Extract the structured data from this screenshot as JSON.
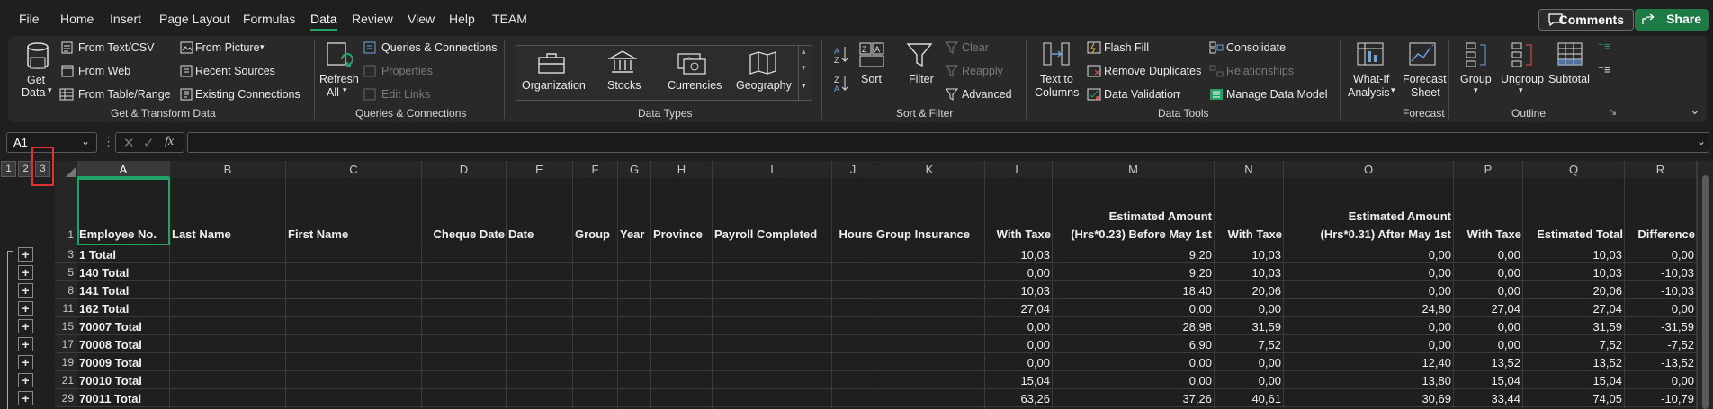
{
  "menu": {
    "tabs": [
      "File",
      "Home",
      "Insert",
      "Page Layout",
      "Formulas",
      "Data",
      "Review",
      "View",
      "Help",
      "TEAM"
    ],
    "active": "Data",
    "comments": "Comments",
    "share": "Share"
  },
  "ribbon": {
    "get_transform": {
      "get_data": "Get",
      "get_data2": "Data",
      "from_text_csv": "From Text/CSV",
      "from_web": "From Web",
      "from_table_range": "From Table/Range",
      "from_picture": "From Picture",
      "recent_sources": "Recent Sources",
      "existing_connections": "Existing Connections",
      "group": "Get & Transform Data"
    },
    "queries": {
      "refresh": "Refresh",
      "refresh2": "All",
      "queries_connections": "Queries & Connections",
      "properties": "Properties",
      "edit_links": "Edit Links",
      "group": "Queries & Connections"
    },
    "data_types": {
      "organization": "Organization",
      "stocks": "Stocks",
      "currencies": "Currencies",
      "geography": "Geography",
      "group": "Data Types"
    },
    "sort_filter": {
      "sort": "Sort",
      "filter": "Filter",
      "clear": "Clear",
      "reapply": "Reapply",
      "advanced": "Advanced",
      "group": "Sort & Filter"
    },
    "data_tools": {
      "text_to_columns": "Text to",
      "text_to_columns2": "Columns",
      "flash_fill": "Flash Fill",
      "remove_duplicates": "Remove Duplicates",
      "data_validation": "Data Validation",
      "consolidate": "Consolidate",
      "relationships": "Relationships",
      "manage_data_model": "Manage Data Model",
      "group": "Data Tools"
    },
    "forecast": {
      "what_if": "What-If",
      "what_if2": "Analysis",
      "forecast_sheet": "Forecast",
      "forecast_sheet2": "Sheet",
      "group": "Forecast"
    },
    "outline": {
      "group_btn": "Group",
      "ungroup": "Ungroup",
      "subtotal": "Subtotal",
      "group": "Outline"
    }
  },
  "formula_bar": {
    "name_box": "A1",
    "fx": "fx",
    "value": ""
  },
  "outline_levels": [
    "1",
    "2",
    "3"
  ],
  "columns": [
    "A",
    "B",
    "C",
    "D",
    "E",
    "F",
    "G",
    "H",
    "I",
    "J",
    "K",
    "L",
    "M",
    "N",
    "O",
    "P",
    "Q",
    "R"
  ],
  "headers": {
    "A": "Employee No.",
    "B": "Last Name",
    "C": "First Name",
    "D": "Cheque Date",
    "E": "Date",
    "F": "Group",
    "G": "Year",
    "H": "Province",
    "I": "Payroll Completed",
    "J": "Hours",
    "K": "Group Insurance",
    "L": "With Taxe",
    "M1": "Estimated Amount",
    "M2": "(Hrs*0.23) Before May 1st",
    "N": "With Taxe",
    "O1": "Estimated Amount",
    "O2": "(Hrs*0.31) After May 1st",
    "P": "With Taxe",
    "Q": "Estimated Total",
    "R": "Difference"
  },
  "rows": [
    {
      "num": "3",
      "A": "1 Total",
      "L": "10,03",
      "M": "9,20",
      "N": "10,03",
      "O": "0,00",
      "P": "0,00",
      "Q": "10,03",
      "R": "0,00"
    },
    {
      "num": "5",
      "A": "140 Total",
      "L": "0,00",
      "M": "9,20",
      "N": "10,03",
      "O": "0,00",
      "P": "0,00",
      "Q": "10,03",
      "R": "-10,03"
    },
    {
      "num": "8",
      "A": "141 Total",
      "L": "10,03",
      "M": "18,40",
      "N": "20,06",
      "O": "0,00",
      "P": "0,00",
      "Q": "20,06",
      "R": "-10,03"
    },
    {
      "num": "11",
      "A": "162 Total",
      "L": "27,04",
      "M": "0,00",
      "N": "0,00",
      "O": "24,80",
      "P": "27,04",
      "Q": "27,04",
      "R": "0,00"
    },
    {
      "num": "15",
      "A": "70007 Total",
      "L": "0,00",
      "M": "28,98",
      "N": "31,59",
      "O": "0,00",
      "P": "0,00",
      "Q": "31,59",
      "R": "-31,59"
    },
    {
      "num": "17",
      "A": "70008 Total",
      "L": "0,00",
      "M": "6,90",
      "N": "7,52",
      "O": "0,00",
      "P": "0,00",
      "Q": "7,52",
      "R": "-7,52"
    },
    {
      "num": "19",
      "A": "70009 Total",
      "L": "0,00",
      "M": "0,00",
      "N": "0,00",
      "O": "12,40",
      "P": "13,52",
      "Q": "13,52",
      "R": "-13,52"
    },
    {
      "num": "21",
      "A": "70010 Total",
      "L": "15,04",
      "M": "0,00",
      "N": "0,00",
      "O": "13,80",
      "P": "15,04",
      "Q": "15,04",
      "R": "0,00"
    },
    {
      "num": "29",
      "A": "70011 Total",
      "L": "63,26",
      "M": "37,26",
      "N": "40,61",
      "O": "30,69",
      "P": "33,44",
      "Q": "74,05",
      "R": "-10,79"
    }
  ]
}
